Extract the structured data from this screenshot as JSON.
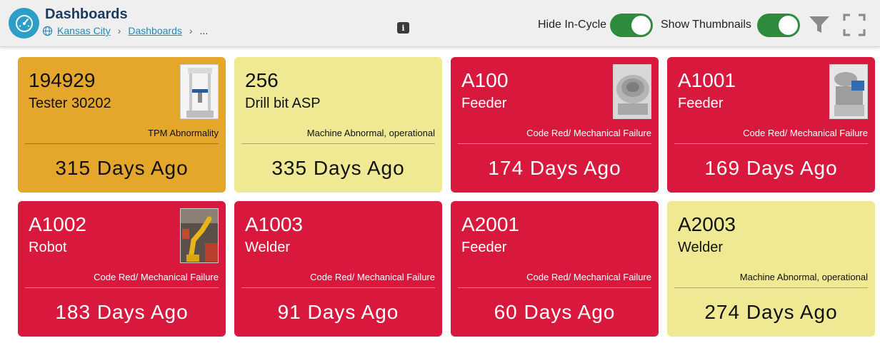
{
  "header": {
    "title": "Dashboards",
    "breadcrumb": [
      "Kansas City",
      "Dashboards",
      "..."
    ],
    "info_label": "i",
    "hide_in_cycle_label": "Hide In-Cycle",
    "show_thumbnails_label": "Show Thumbnails",
    "hide_in_cycle_on": true,
    "show_thumbnails_on": true
  },
  "colors": {
    "orange": "#e5a72b",
    "yellow": "#efe994",
    "red": "#d8193d",
    "toggle_on": "#2e8b3e",
    "brand": "#2d9ec8"
  },
  "cards": [
    {
      "id": "194929",
      "name": "Tester 30202",
      "status": "TPM Abnormality",
      "days": "315 Days Ago",
      "color": "orange",
      "thumbnail": "tester-machine"
    },
    {
      "id": "256",
      "name": "Drill bit ASP",
      "status": "Machine Abnormal, operational",
      "days": "335 Days Ago",
      "color": "yellow",
      "thumbnail": ""
    },
    {
      "id": "A100",
      "name": "Feeder",
      "status": "Code Red/ Mechanical Failure",
      "days": "174 Days Ago",
      "color": "red",
      "thumbnail": "bowl-feeder"
    },
    {
      "id": "A1001",
      "name": "Feeder",
      "status": "Code Red/ Mechanical Failure",
      "days": "169 Days Ago",
      "color": "red",
      "thumbnail": "feeder-machine"
    },
    {
      "id": "A1002",
      "name": "Robot",
      "status": "Code Red/ Mechanical Failure",
      "days": "183 Days Ago",
      "color": "red",
      "thumbnail": "robot-arm"
    },
    {
      "id": "A1003",
      "name": "Welder",
      "status": "Code Red/ Mechanical Failure",
      "days": "91 Days Ago",
      "color": "red",
      "thumbnail": ""
    },
    {
      "id": "A2001",
      "name": "Feeder",
      "status": "Code Red/ Mechanical Failure",
      "days": "60 Days Ago",
      "color": "red",
      "thumbnail": ""
    },
    {
      "id": "A2003",
      "name": "Welder",
      "status": "Machine Abnormal, operational",
      "days": "274 Days Ago",
      "color": "yellow",
      "thumbnail": ""
    }
  ]
}
